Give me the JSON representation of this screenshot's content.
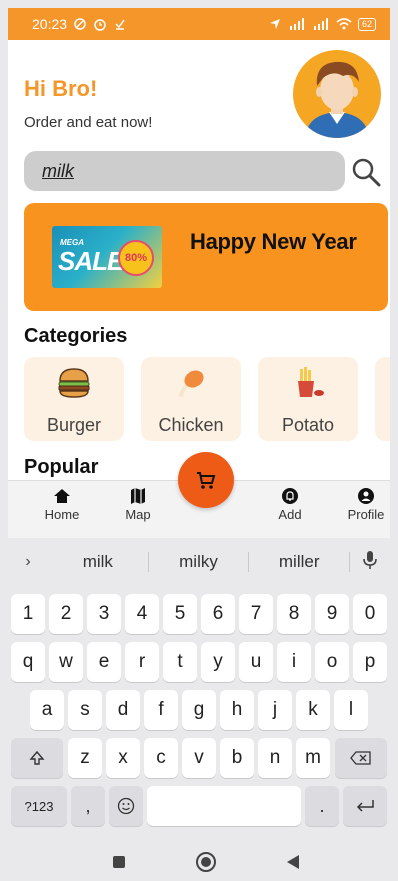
{
  "status": {
    "time": "20:23",
    "battery": "62"
  },
  "header": {
    "greeting": "Hi Bro!",
    "subtitle": "Order and eat now!"
  },
  "search": {
    "value": "milk"
  },
  "banner": {
    "sale_small": "MEGA",
    "sale_word": "SALE",
    "sale_discount": "80%",
    "title": "Happy New Year"
  },
  "sections": {
    "categories": "Categories",
    "popular": "Popular"
  },
  "categories": [
    {
      "label": "Burger",
      "icon": "burger-icon"
    },
    {
      "label": "Chicken",
      "icon": "chicken-leg-icon"
    },
    {
      "label": "Potato",
      "icon": "fries-icon"
    }
  ],
  "nav": {
    "home": "Home",
    "map": "Map",
    "add": "Add",
    "profile": "Profile"
  },
  "keyboard": {
    "suggestions": [
      "milk",
      "milky",
      "miller"
    ],
    "row1": [
      "1",
      "2",
      "3",
      "4",
      "5",
      "6",
      "7",
      "8",
      "9",
      "0"
    ],
    "row2": [
      "q",
      "w",
      "e",
      "r",
      "t",
      "y",
      "u",
      "i",
      "o",
      "p"
    ],
    "row3": [
      "a",
      "s",
      "d",
      "f",
      "g",
      "h",
      "j",
      "k",
      "l"
    ],
    "row4": [
      "z",
      "x",
      "c",
      "v",
      "b",
      "n",
      "m"
    ],
    "symbols": "?123",
    "comma": ",",
    "period": "."
  },
  "colors": {
    "accent": "#f5962a",
    "banner": "#f7931e",
    "fab": "#ee5b16",
    "category_bg": "#fdf1e3"
  }
}
